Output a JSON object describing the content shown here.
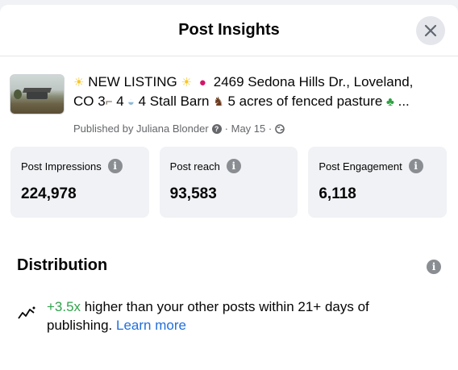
{
  "header": {
    "title": "Post Insights",
    "close_icon": "close-icon"
  },
  "post": {
    "text_line1_a": "NEW LISTING",
    "text_line1_b": "2469 Sedona Hills Dr., Loveland,",
    "text_line2_a": "CO 3",
    "text_line2_b": "4",
    "text_line2_c": "4 Stall Barn",
    "text_line2_d": "5 acres of fenced pasture",
    "ellipsis": "...",
    "published_by": "Published by Juliana Blonder",
    "date": "· May 15 ·",
    "emojis": {
      "sun": "sun-emoji",
      "pin": "pin-emoji",
      "bed": "bed-emoji",
      "bath": "bath-emoji",
      "horse": "horse-emoji",
      "clover": "clover-emoji",
      "globe": "globe-icon"
    }
  },
  "metrics": [
    {
      "label": "Post Impressions",
      "value": "224,978"
    },
    {
      "label": "Post reach",
      "value": "93,583"
    },
    {
      "label": "Post Engagement",
      "value": "6,118"
    }
  ],
  "distribution": {
    "title": "Distribution",
    "highlight": "+3.5x",
    "text_a": " higher than your other posts within 21+ days of publishing. ",
    "learn_more": "Learn more"
  },
  "colors": {
    "accent_green": "#31a24c",
    "link_blue": "#216fdb",
    "card_bg": "#f0f2f5"
  }
}
